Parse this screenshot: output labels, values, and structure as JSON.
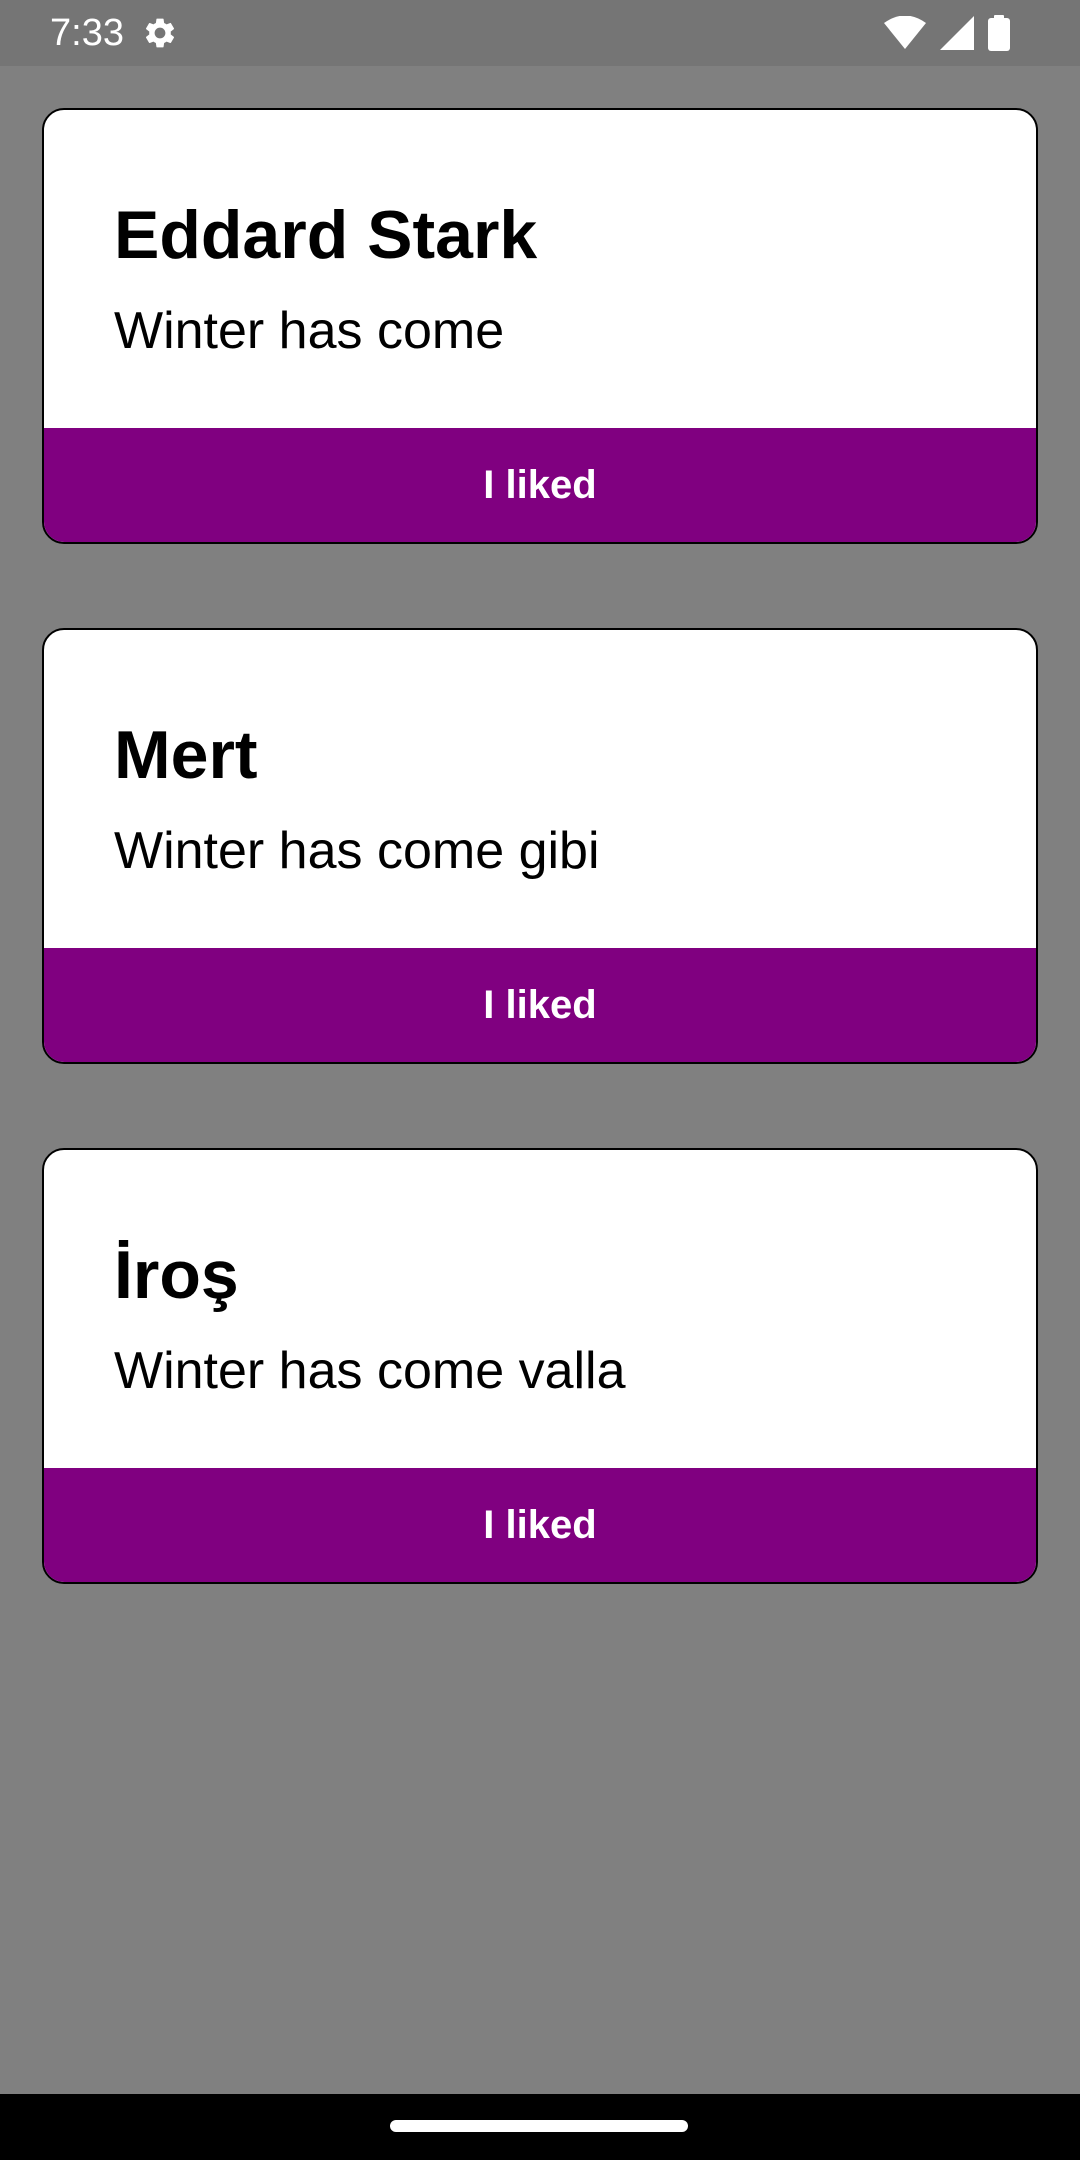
{
  "status_bar": {
    "time": "7:33",
    "icons": [
      "settings-gear-icon",
      "wifi-icon",
      "cellular-signal-icon",
      "battery-icon"
    ]
  },
  "cards": [
    {
      "name": "Eddard Stark",
      "quote": "Winter has come",
      "button_label": "I liked"
    },
    {
      "name": "Mert",
      "quote": "Winter has come gibi",
      "button_label": "I liked"
    },
    {
      "name": "İroş",
      "quote": "Winter has come valla",
      "button_label": "I liked"
    }
  ],
  "colors": {
    "background": "#808080",
    "status_bar": "#757575",
    "card_background": "#ffffff",
    "button": "#800080",
    "button_text": "#ffffff",
    "nav_bar": "#000000"
  }
}
